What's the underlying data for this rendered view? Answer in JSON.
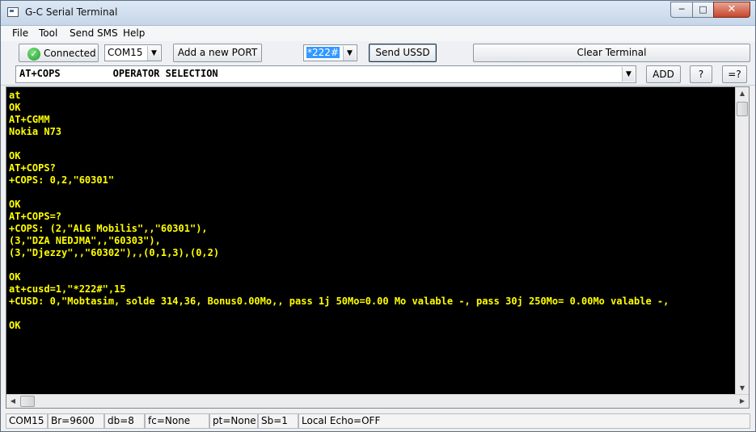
{
  "window": {
    "title": "G-C Serial Terminal"
  },
  "menu": [
    "File",
    "Tool",
    "Send SMS",
    "Help"
  ],
  "toolbar": {
    "connected_label": "Connected",
    "port_value": "COM15",
    "add_port_label": "Add a new PORT #",
    "ussd_value": "*222#",
    "send_ussd_label": "Send USSD",
    "clear_terminal_label": "Clear Terminal",
    "command_value": "AT+COPS         OPERATOR SELECTION",
    "add_label": "ADD",
    "help_label": "?",
    "query_label": "=?"
  },
  "terminal": {
    "lines": [
      "at",
      "OK",
      "AT+CGMM",
      "Nokia N73",
      "",
      "OK",
      "AT+COPS?",
      "+COPS: 0,2,\"60301\"",
      "",
      "OK",
      "AT+COPS=?",
      "+COPS: (2,\"ALG Mobilis\",,\"60301\"),",
      "(3,\"DZA NEDJMA\",,\"60303\"),",
      "(3,\"Djezzy\",,\"60302\"),,(0,1,3),(0,2)",
      "",
      "OK",
      "at+cusd=1,\"*222#\",15",
      "+CUSD: 0,\"Mobtasim, solde 314,36, Bonus0.00Mo,, pass 1j 50Mo=0.00 Mo valable -, pass 30j 250Mo= 0.00Mo valable -,",
      "",
      "OK"
    ]
  },
  "status": {
    "port": "COM15",
    "baud": "Br=9600",
    "databits": "db=8",
    "flow": "fc=None",
    "parity": "pt=None",
    "stopbits": "Sb=1",
    "echo": "Local Echo=OFF"
  },
  "colors": {
    "terminal_bg": "#000000",
    "terminal_fg": "#ffff00"
  }
}
